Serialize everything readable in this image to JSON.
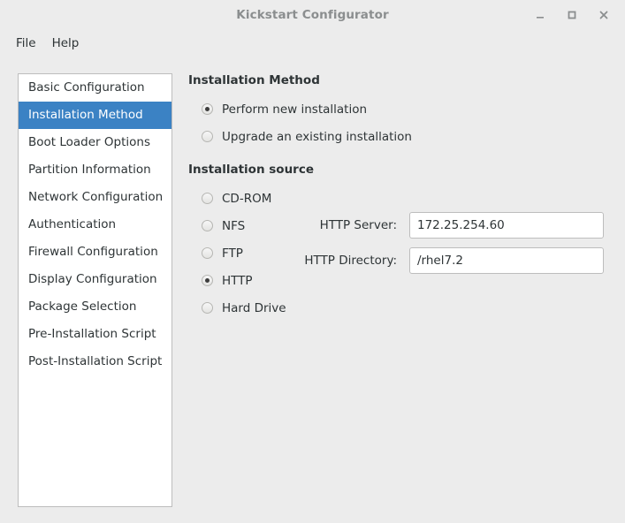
{
  "window": {
    "title": "Kickstart Configurator",
    "controls": [
      {
        "name": "minimize-button",
        "glyph": "_"
      },
      {
        "name": "maximize-button",
        "glyph": "□"
      },
      {
        "name": "close-button",
        "glyph": "×"
      }
    ]
  },
  "menubar": {
    "items": [
      {
        "label": "File"
      },
      {
        "label": "Help"
      }
    ]
  },
  "sidebar": {
    "items": [
      {
        "label": "Basic Configuration",
        "selected": false
      },
      {
        "label": "Installation Method",
        "selected": true
      },
      {
        "label": "Boot Loader Options",
        "selected": false
      },
      {
        "label": "Partition Information",
        "selected": false
      },
      {
        "label": "Network Configuration",
        "selected": false
      },
      {
        "label": "Authentication",
        "selected": false
      },
      {
        "label": "Firewall Configuration",
        "selected": false
      },
      {
        "label": "Display Configuration",
        "selected": false
      },
      {
        "label": "Package Selection",
        "selected": false
      },
      {
        "label": "Pre-Installation Script",
        "selected": false
      },
      {
        "label": "Post-Installation Script",
        "selected": false
      }
    ]
  },
  "main": {
    "install_method": {
      "heading": "Installation Method",
      "options": [
        {
          "label": "Perform new installation",
          "checked": true
        },
        {
          "label": "Upgrade an existing installation",
          "checked": false
        }
      ]
    },
    "install_source": {
      "heading": "Installation source",
      "options": [
        {
          "label": "CD-ROM",
          "checked": false
        },
        {
          "label": "NFS",
          "checked": false
        },
        {
          "label": "FTP",
          "checked": false
        },
        {
          "label": "HTTP",
          "checked": true
        },
        {
          "label": "Hard Drive",
          "checked": false
        }
      ],
      "fields": [
        {
          "label": "HTTP Server:",
          "value": "172.25.254.60",
          "placeholder": ""
        },
        {
          "label": "HTTP Directory:",
          "value": "/rhel7.2",
          "placeholder": ""
        }
      ]
    }
  },
  "colors": {
    "window_bg": "#ececec",
    "selection": "#3b82c4",
    "text": "#2e3436",
    "title_text": "#8b8e8f",
    "border": "#bdbdbd"
  }
}
